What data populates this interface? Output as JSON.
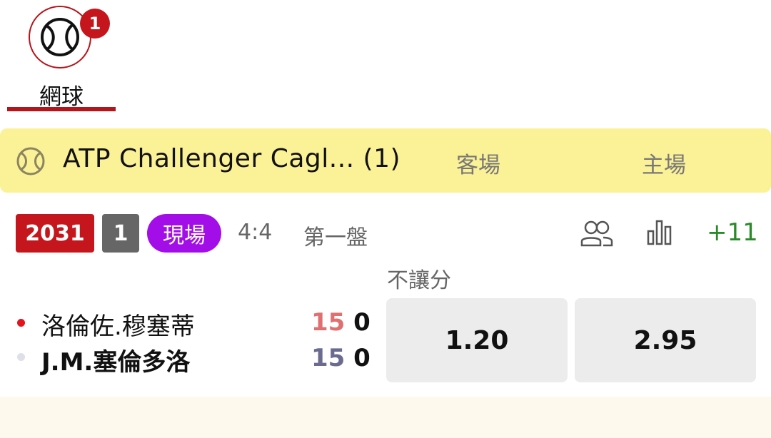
{
  "sport_tab": {
    "badge": "1",
    "label": "網球"
  },
  "league": {
    "title": "ATP Challenger Cagl... (1)",
    "col_away": "客場",
    "col_home": "主場"
  },
  "match": {
    "id": "2031",
    "num": "1",
    "live_label": "現場",
    "set_score": "4:4",
    "set_name": "第一盤",
    "more_markets": "+11",
    "market_label": "不讓分",
    "players": [
      {
        "name": "洛倫佐.穆塞蒂",
        "points": "15",
        "games": "0",
        "serving": true
      },
      {
        "name": "J.M.塞倫多洛",
        "points": "15",
        "games": "0",
        "serving": false
      }
    ],
    "odds": {
      "away": "1.20",
      "home": "2.95"
    }
  },
  "icons": {
    "sport": "tennis-ball-icon",
    "league": "tennis-ball-icon",
    "players": "players-icon",
    "stats": "bar-chart-icon"
  },
  "colors": {
    "brand_red": "#c4161c",
    "league_bar": "#fbf196",
    "live": "#a30ee8",
    "more_green": "#2a8a2a"
  }
}
